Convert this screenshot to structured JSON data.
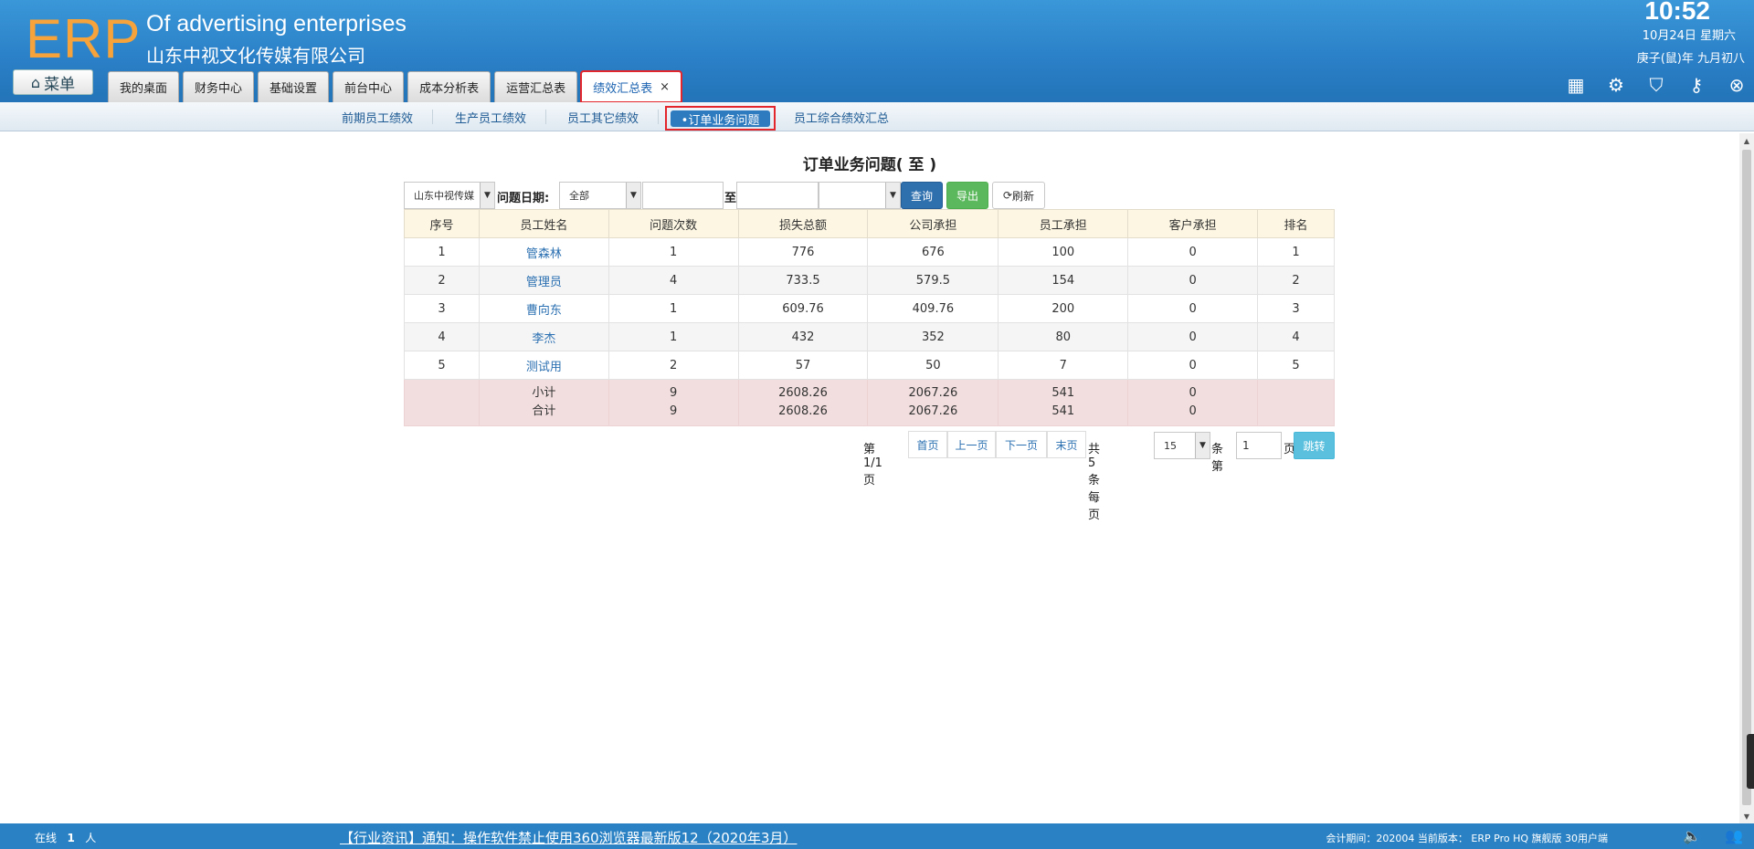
{
  "header": {
    "logo": "ERP",
    "brand_en": "Of advertising enterprises",
    "brand_cn": "山东中视文化传媒有限公司",
    "time": "10:52",
    "date_line": "10月24日 星期六",
    "lunar_line": "庚子(鼠)年 九月初八",
    "menu_label": "菜单"
  },
  "tabs": [
    {
      "label": "我的桌面"
    },
    {
      "label": "财务中心"
    },
    {
      "label": "基础设置"
    },
    {
      "label": "前台中心"
    },
    {
      "label": "成本分析表"
    },
    {
      "label": "运营汇总表"
    },
    {
      "label": "绩效汇总表",
      "close": "×"
    }
  ],
  "subnav": {
    "items": [
      "前期员工绩效",
      "生产员工绩效",
      "员工其它绩效",
      "•订单业务问题",
      "员工综合绩效汇总"
    ]
  },
  "page": {
    "title": "订单业务问题( 至 )"
  },
  "filter": {
    "company": "山东中视传媒",
    "date_label": "问题日期:",
    "range": "全部",
    "to_label": "至",
    "query": "查询",
    "export": "导出",
    "refresh": "刷新"
  },
  "table": {
    "headers": [
      "序号",
      "员工姓名",
      "问题次数",
      "损失总额",
      "公司承担",
      "员工承担",
      "客户承担",
      "排名"
    ],
    "rows": [
      [
        "1",
        "管森林",
        "1",
        "776",
        "676",
        "100",
        "0",
        "1"
      ],
      [
        "2",
        "管理员",
        "4",
        "733.5",
        "579.5",
        "154",
        "0",
        "2"
      ],
      [
        "3",
        "曹向东",
        "1",
        "609.76",
        "409.76",
        "200",
        "0",
        "3"
      ],
      [
        "4",
        "李杰",
        "1",
        "432",
        "352",
        "80",
        "0",
        "4"
      ],
      [
        "5",
        "测试用",
        "2",
        "57",
        "50",
        "7",
        "0",
        "5"
      ]
    ],
    "subtotal": [
      "小计",
      "9",
      "2608.26",
      "2067.26",
      "541",
      "0"
    ],
    "total": [
      "合计",
      "9",
      "2608.26",
      "2067.26",
      "541",
      "0"
    ]
  },
  "pager": {
    "page_info": "第1/1页",
    "first": "首页",
    "prev": "上一页",
    "next": "下一页",
    "last": "末页",
    "count_info": "共5条每页",
    "per_page": "15",
    "per_unit": "条第",
    "page_input": "1",
    "page_unit": "页",
    "go": "跳转"
  },
  "footer": {
    "online_label": "在线",
    "online_count": "1",
    "online_unit": "人",
    "news": "【行业资讯】通知：操作软件禁止使用360浏览器最新版12（2020年3月）",
    "info": "会计期间：202004 当前版本： ERP Pro HQ 旗舰版 30用户端"
  }
}
